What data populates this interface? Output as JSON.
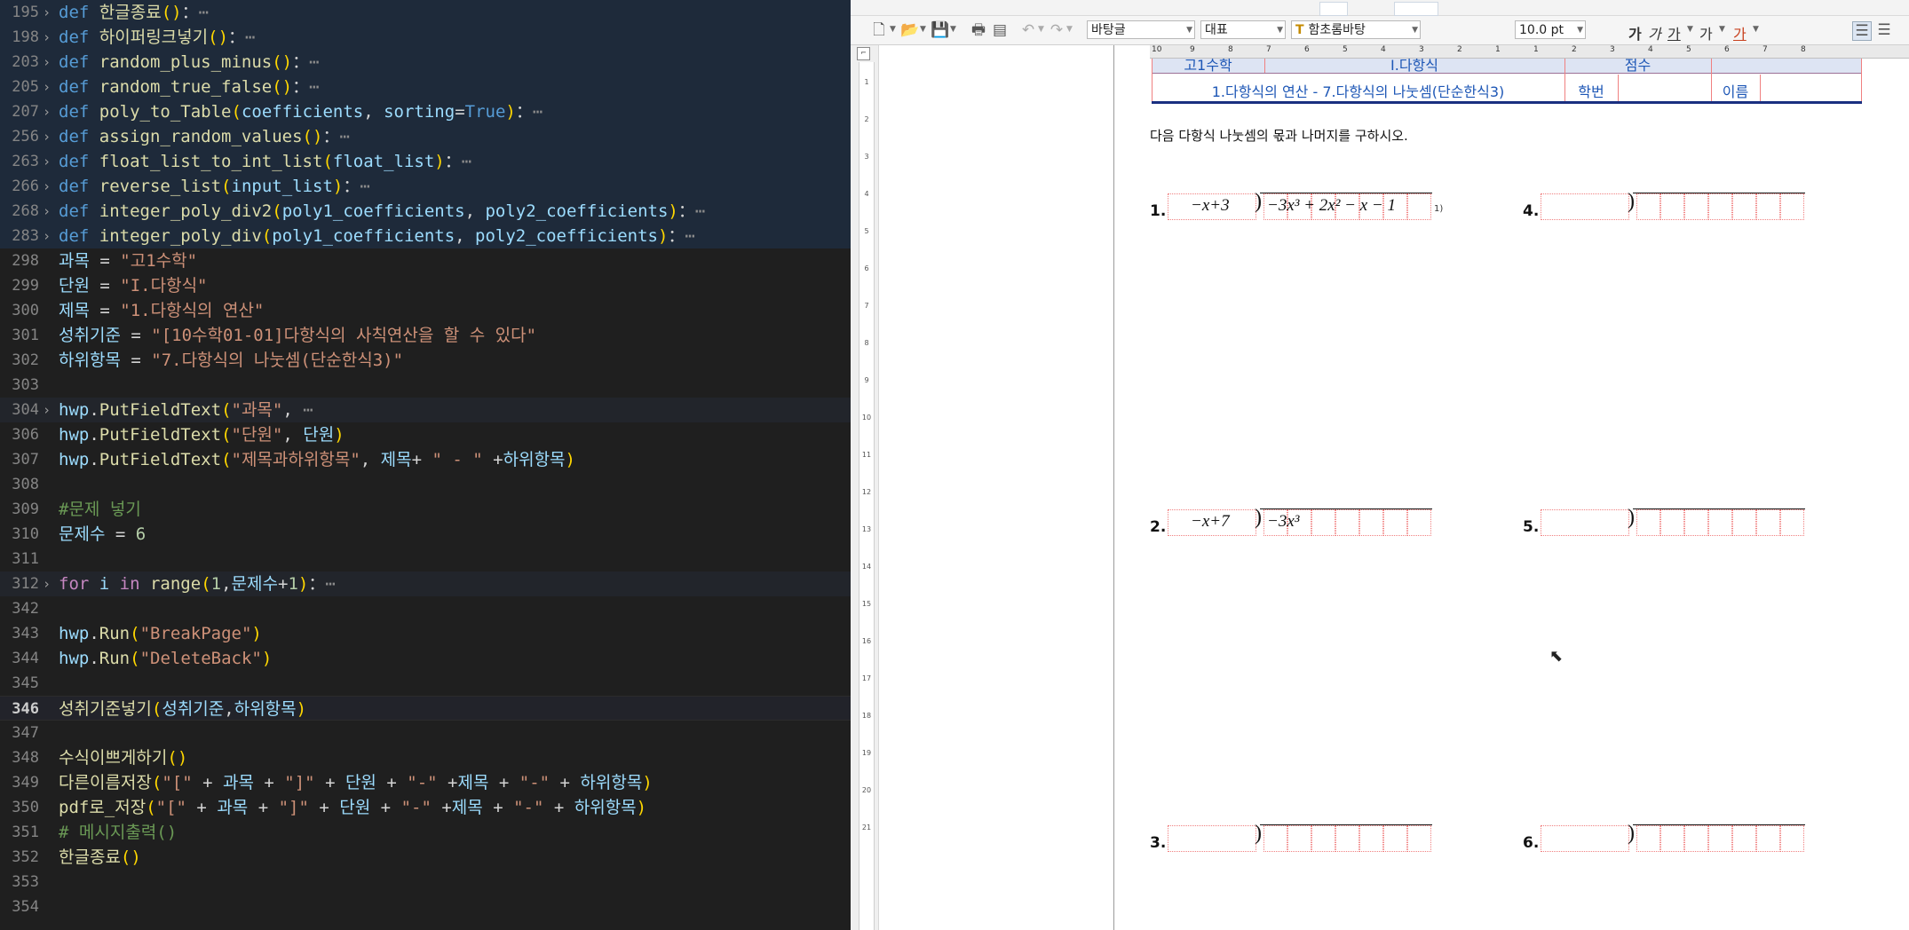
{
  "editor": {
    "lines": [
      {
        "num": "195",
        "fold": true,
        "hl": true,
        "tokens": [
          [
            "k",
            "def "
          ],
          [
            "f",
            "한글종료"
          ],
          [
            "b",
            "()"
          ],
          [
            "",
            "："
          ],
          [
            "dots",
            "⋯"
          ]
        ]
      },
      {
        "num": "198",
        "fold": true,
        "hl": true,
        "tokens": [
          [
            "k",
            "def "
          ],
          [
            "f",
            "하이퍼링크넣기"
          ],
          [
            "b",
            "()"
          ],
          [
            "",
            "："
          ],
          [
            "dots",
            "⋯"
          ]
        ]
      },
      {
        "num": "203",
        "fold": true,
        "hl": true,
        "tokens": [
          [
            "k",
            "def "
          ],
          [
            "f",
            "random_plus_minus"
          ],
          [
            "b",
            "()"
          ],
          [
            "",
            "："
          ],
          [
            "dots",
            "⋯"
          ]
        ]
      },
      {
        "num": "205",
        "fold": true,
        "hl": true,
        "tokens": [
          [
            "k",
            "def "
          ],
          [
            "f",
            "random_true_false"
          ],
          [
            "b",
            "()"
          ],
          [
            "",
            "："
          ],
          [
            "dots",
            "⋯"
          ]
        ]
      },
      {
        "num": "207",
        "fold": true,
        "hl": true,
        "tokens": [
          [
            "k",
            "def "
          ],
          [
            "f",
            "poly_to_Table"
          ],
          [
            "b",
            "("
          ],
          [
            "p",
            "coefficients"
          ],
          [
            "",
            ", "
          ],
          [
            "p",
            "sorting"
          ],
          [
            "",
            "="
          ],
          [
            "k",
            "True"
          ],
          [
            "b",
            ")"
          ],
          [
            "",
            "："
          ],
          [
            "dots",
            "⋯"
          ]
        ]
      },
      {
        "num": "256",
        "fold": true,
        "hl": true,
        "tokens": [
          [
            "k",
            "def "
          ],
          [
            "f",
            "assign_random_values"
          ],
          [
            "b",
            "()"
          ],
          [
            "",
            "："
          ],
          [
            "dots",
            "⋯"
          ]
        ]
      },
      {
        "num": "263",
        "fold": true,
        "hl": true,
        "tokens": [
          [
            "k",
            "def "
          ],
          [
            "f",
            "float_list_to_int_list"
          ],
          [
            "b",
            "("
          ],
          [
            "p",
            "float_list"
          ],
          [
            "b",
            ")"
          ],
          [
            "",
            "："
          ],
          [
            "dots",
            "⋯"
          ]
        ]
      },
      {
        "num": "266",
        "fold": true,
        "hl": true,
        "tokens": [
          [
            "k",
            "def "
          ],
          [
            "f",
            "reverse_list"
          ],
          [
            "b",
            "("
          ],
          [
            "p",
            "input_list"
          ],
          [
            "b",
            ")"
          ],
          [
            "",
            "："
          ],
          [
            "dots",
            "⋯"
          ]
        ]
      },
      {
        "num": "268",
        "fold": true,
        "hl": true,
        "tokens": [
          [
            "k",
            "def "
          ],
          [
            "f",
            "integer_poly_div2"
          ],
          [
            "b",
            "("
          ],
          [
            "p",
            "poly1_coefficients"
          ],
          [
            "",
            ", "
          ],
          [
            "p",
            "poly2_coefficients"
          ],
          [
            "b",
            ")"
          ],
          [
            "",
            "："
          ],
          [
            "dots",
            "⋯"
          ]
        ]
      },
      {
        "num": "283",
        "fold": true,
        "hl": true,
        "tokens": [
          [
            "k",
            "def "
          ],
          [
            "f",
            "integer_poly_div"
          ],
          [
            "b",
            "("
          ],
          [
            "p",
            "poly1_coefficients"
          ],
          [
            "",
            ", "
          ],
          [
            "p",
            "poly2_coefficients"
          ],
          [
            "b",
            ")"
          ],
          [
            "",
            "："
          ],
          [
            "dots",
            "⋯"
          ]
        ]
      },
      {
        "num": "298",
        "fold": false,
        "hl": false,
        "tokens": [
          [
            "p",
            "과목"
          ],
          [
            "",
            " = "
          ],
          [
            "s",
            "\"고1수학\""
          ]
        ]
      },
      {
        "num": "299",
        "fold": false,
        "hl": false,
        "tokens": [
          [
            "p",
            "단원"
          ],
          [
            "",
            " = "
          ],
          [
            "s",
            "\"I.다항식\""
          ]
        ]
      },
      {
        "num": "300",
        "fold": false,
        "hl": false,
        "tokens": [
          [
            "p",
            "제목"
          ],
          [
            "",
            " = "
          ],
          [
            "s",
            "\"1.다항식의 연산\""
          ]
        ]
      },
      {
        "num": "301",
        "fold": false,
        "hl": false,
        "tokens": [
          [
            "p",
            "성취기준"
          ],
          [
            "",
            " = "
          ],
          [
            "s",
            "\"[10수학01-01]다항식의 사칙연산을 할 수 있다\""
          ]
        ]
      },
      {
        "num": "302",
        "fold": false,
        "hl": false,
        "tokens": [
          [
            "p",
            "하위항목"
          ],
          [
            "",
            " = "
          ],
          [
            "s",
            "\"7.다항식의 나눗셈(단순한식3)\""
          ]
        ]
      },
      {
        "num": "303",
        "fold": false,
        "hl": false,
        "tokens": []
      },
      {
        "num": "304",
        "fold": true,
        "hl": false,
        "sel": true,
        "tokens": [
          [
            "p",
            "hwp"
          ],
          [
            "",
            "."
          ],
          [
            "f",
            "PutFieldText"
          ],
          [
            "b",
            "("
          ],
          [
            "s",
            "\"과목\""
          ],
          [
            "",
            ", "
          ],
          [
            "dots",
            "⋯"
          ]
        ]
      },
      {
        "num": "306",
        "fold": false,
        "hl": false,
        "tokens": [
          [
            "p",
            "hwp"
          ],
          [
            "",
            "."
          ],
          [
            "f",
            "PutFieldText"
          ],
          [
            "b",
            "("
          ],
          [
            "s",
            "\"단원\""
          ],
          [
            "",
            ", "
          ],
          [
            "p",
            "단원"
          ],
          [
            "b",
            ")"
          ]
        ]
      },
      {
        "num": "307",
        "fold": false,
        "hl": false,
        "tokens": [
          [
            "p",
            "hwp"
          ],
          [
            "",
            "."
          ],
          [
            "f",
            "PutFieldText"
          ],
          [
            "b",
            "("
          ],
          [
            "s",
            "\"제목과하위항목\""
          ],
          [
            "",
            ", "
          ],
          [
            "p",
            "제목"
          ],
          [
            "",
            "+ "
          ],
          [
            "s",
            "\" - \""
          ],
          [
            "",
            " +"
          ],
          [
            "p",
            "하위항목"
          ],
          [
            "b",
            ")"
          ]
        ]
      },
      {
        "num": "308",
        "fold": false,
        "hl": false,
        "tokens": []
      },
      {
        "num": "309",
        "fold": false,
        "hl": false,
        "tokens": [
          [
            "c",
            "#문제 넣기"
          ]
        ]
      },
      {
        "num": "310",
        "fold": false,
        "hl": false,
        "tokens": [
          [
            "p",
            "문제수"
          ],
          [
            "",
            " = "
          ],
          [
            "n",
            "6"
          ]
        ]
      },
      {
        "num": "311",
        "fold": false,
        "hl": false,
        "tokens": []
      },
      {
        "num": "312",
        "fold": true,
        "hl": false,
        "sel": true,
        "tokens": [
          [
            "cf",
            "for "
          ],
          [
            "p",
            "i"
          ],
          [
            "cf",
            " in "
          ],
          [
            "f",
            "range"
          ],
          [
            "b",
            "("
          ],
          [
            "n",
            "1"
          ],
          [
            "",
            ","
          ],
          [
            "p",
            "문제수"
          ],
          [
            "",
            "+"
          ],
          [
            "n",
            "1"
          ],
          [
            "b",
            ")"
          ],
          [
            "",
            "："
          ],
          [
            "dots",
            "⋯"
          ]
        ]
      },
      {
        "num": "342",
        "fold": false,
        "hl": false,
        "tokens": []
      },
      {
        "num": "343",
        "fold": false,
        "hl": false,
        "tokens": [
          [
            "p",
            "hwp"
          ],
          [
            "",
            "."
          ],
          [
            "f",
            "Run"
          ],
          [
            "b",
            "("
          ],
          [
            "s",
            "\"BreakPage\""
          ],
          [
            "b",
            ")"
          ]
        ]
      },
      {
        "num": "344",
        "fold": false,
        "hl": false,
        "tokens": [
          [
            "p",
            "hwp"
          ],
          [
            "",
            "."
          ],
          [
            "f",
            "Run"
          ],
          [
            "b",
            "("
          ],
          [
            "s",
            "\"DeleteBack\""
          ],
          [
            "b",
            ")"
          ]
        ]
      },
      {
        "num": "345",
        "fold": false,
        "hl": false,
        "tokens": []
      },
      {
        "num": "346",
        "fold": false,
        "hl": false,
        "active": true,
        "tokens": [
          [
            "f",
            "성취기준넣기"
          ],
          [
            "b",
            "("
          ],
          [
            "p",
            "성취기준"
          ],
          [
            "",
            ","
          ],
          [
            "p",
            "하위항목"
          ],
          [
            "b",
            ")"
          ]
        ]
      },
      {
        "num": "347",
        "fold": false,
        "hl": false,
        "tokens": []
      },
      {
        "num": "348",
        "fold": false,
        "hl": false,
        "tokens": [
          [
            "f",
            "수식이쁘게하기"
          ],
          [
            "b",
            "()"
          ]
        ]
      },
      {
        "num": "349",
        "fold": false,
        "hl": false,
        "tokens": [
          [
            "f",
            "다른이름저장"
          ],
          [
            "b",
            "("
          ],
          [
            "s",
            "\"[\""
          ],
          [
            "",
            " + "
          ],
          [
            "p",
            "과목"
          ],
          [
            "",
            " + "
          ],
          [
            "s",
            "\"]\""
          ],
          [
            "",
            " + "
          ],
          [
            "p",
            "단원"
          ],
          [
            "",
            " + "
          ],
          [
            "s",
            "\"-\""
          ],
          [
            "",
            " +"
          ],
          [
            "p",
            "제목"
          ],
          [
            "",
            " + "
          ],
          [
            "s",
            "\"-\""
          ],
          [
            "",
            " + "
          ],
          [
            "p",
            "하위항목"
          ],
          [
            "b",
            ")"
          ]
        ]
      },
      {
        "num": "350",
        "fold": false,
        "hl": false,
        "tokens": [
          [
            "f",
            "pdf로_저장"
          ],
          [
            "b",
            "("
          ],
          [
            "s",
            "\"[\""
          ],
          [
            "",
            " + "
          ],
          [
            "p",
            "과목"
          ],
          [
            "",
            " + "
          ],
          [
            "s",
            "\"]\""
          ],
          [
            "",
            " + "
          ],
          [
            "p",
            "단원"
          ],
          [
            "",
            " + "
          ],
          [
            "s",
            "\"-\""
          ],
          [
            "",
            " +"
          ],
          [
            "p",
            "제목"
          ],
          [
            "",
            " + "
          ],
          [
            "s",
            "\"-\""
          ],
          [
            "",
            " + "
          ],
          [
            "p",
            "하위항목"
          ],
          [
            "b",
            ")"
          ]
        ]
      },
      {
        "num": "351",
        "fold": false,
        "hl": false,
        "tokens": [
          [
            "c",
            "# 메시지출력()"
          ]
        ]
      },
      {
        "num": "352",
        "fold": false,
        "hl": false,
        "tokens": [
          [
            "f",
            "한글종료"
          ],
          [
            "b",
            "()"
          ]
        ]
      },
      {
        "num": "353",
        "fold": false,
        "hl": false,
        "tokens": []
      },
      {
        "num": "354",
        "fold": false,
        "hl": false,
        "tokens": []
      }
    ]
  },
  "hwp": {
    "toolbar": {
      "style_combo": "바탕글",
      "lang_combo": "대표",
      "font_combo": "함초롬바탕",
      "size_combo": "10.0",
      "size_unit": "pt",
      "bold": "가",
      "italic": "가",
      "underline": "가",
      "strike": "가",
      "fontcolor": "가"
    },
    "header": {
      "subject": "고1수학",
      "unit": "I.다항식",
      "score_label": "점수",
      "title": "1.다항식의 연산 - 7.다항식의 나눗셈(단순한식3)",
      "student_id_label": "학번",
      "name_label": "이름"
    },
    "instruction": "다음 다항식 나눗셈의 몫과 나머지를 구하시오.",
    "problems": [
      {
        "label": "1.",
        "divisor": "−x+3",
        "dividend": "−3x³ + 2x² −  x  −  1",
        "footnote": "1)"
      },
      {
        "label": "4.",
        "divisor": "",
        "dividend": ""
      },
      {
        "label": "2.",
        "divisor": "−x+7",
        "dividend": "−3x³"
      },
      {
        "label": "5.",
        "divisor": "",
        "dividend": ""
      },
      {
        "label": "3.",
        "divisor": "",
        "dividend": ""
      },
      {
        "label": "6.",
        "divisor": "",
        "dividend": ""
      }
    ],
    "vruler_ticks": [
      "1",
      "2",
      "3",
      "4",
      "5",
      "6",
      "7",
      "8",
      "9",
      "10",
      "11",
      "12",
      "13",
      "14",
      "15",
      "16",
      "17",
      "18",
      "19",
      "20",
      "21"
    ],
    "hruler_ticks": [
      "10",
      "9",
      "8",
      "7",
      "6",
      "5",
      "4",
      "3",
      "2",
      "1",
      "1",
      "2",
      "3",
      "4",
      "5",
      "6",
      "7",
      "8"
    ]
  }
}
